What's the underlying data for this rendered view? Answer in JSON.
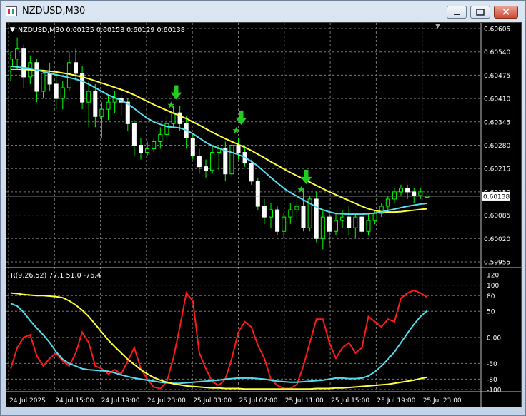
{
  "window": {
    "title": "NZDUSD,M30",
    "minimize_label": "",
    "maximize_label": "",
    "close_label": "×"
  },
  "chart_info": "NZDUSD,M30  0.60135 0.60158 0.60129 0.60138",
  "price_axis_labels": [
    "0.60605",
    "0.60540",
    "0.60475",
    "0.60410",
    "0.60345",
    "0.60280",
    "0.60215",
    "0.60150",
    "0.60085",
    "0.60020",
    "0.59955"
  ],
  "current_price": "0.60138",
  "indicator_info": "R(9,26,52) 77.1 51.0 -76.4",
  "indicator_axis_labels": [
    "120",
    "100",
    "80",
    "50",
    "0.00",
    "-50",
    "-80",
    "-100"
  ],
  "time_labels": [
    "24 Jul 2025",
    "24 Jul 15:00",
    "24 Jul 19:00",
    "24 Jul 23:00",
    "25 Jul 03:00",
    "25 Jul 07:00",
    "25 Jul 11:00",
    "25 Jul 15:00",
    "25 Jul 19:00",
    "25 Jul 23:00"
  ],
  "colors": {
    "background": "#000000",
    "bull_candle": "#ffffff",
    "bear_candle": "#00ff00",
    "fast_ma": "#55dded",
    "slow_ma": "#ffff3c",
    "signal_arrow": "#22cc22",
    "osc_fast": "#ff1a1a",
    "osc_mid": "#55dded",
    "osc_slow": "#ffff3c",
    "grid": "#777777"
  },
  "chart_data": [
    {
      "type": "candlestick",
      "symbol": "NZDUSD",
      "timeframe": "M30",
      "ylim": [
        0.59955,
        0.60605
      ],
      "candles": [
        {
          "o": 0.605,
          "h": 0.6054,
          "l": 0.6046,
          "c": 0.6052
        },
        {
          "o": 0.6052,
          "h": 0.6058,
          "l": 0.6049,
          "c": 0.6055
        },
        {
          "o": 0.6055,
          "h": 0.6056,
          "l": 0.6044,
          "c": 0.6047
        },
        {
          "o": 0.6047,
          "h": 0.6053,
          "l": 0.6045,
          "c": 0.6051
        },
        {
          "o": 0.6051,
          "h": 0.6052,
          "l": 0.604,
          "c": 0.6043
        },
        {
          "o": 0.6043,
          "h": 0.6049,
          "l": 0.6041,
          "c": 0.6048
        },
        {
          "o": 0.6048,
          "h": 0.6051,
          "l": 0.6043,
          "c": 0.6045
        },
        {
          "o": 0.6045,
          "h": 0.6048,
          "l": 0.6038,
          "c": 0.6041
        },
        {
          "o": 0.6041,
          "h": 0.6046,
          "l": 0.6038,
          "c": 0.6044
        },
        {
          "o": 0.6044,
          "h": 0.6054,
          "l": 0.6043,
          "c": 0.6051
        },
        {
          "o": 0.6051,
          "h": 0.6055,
          "l": 0.6046,
          "c": 0.6048
        },
        {
          "o": 0.6048,
          "h": 0.605,
          "l": 0.6038,
          "c": 0.604
        },
        {
          "o": 0.604,
          "h": 0.6046,
          "l": 0.6033,
          "c": 0.6043
        },
        {
          "o": 0.6043,
          "h": 0.6045,
          "l": 0.6033,
          "c": 0.6036
        },
        {
          "o": 0.6036,
          "h": 0.604,
          "l": 0.603,
          "c": 0.6038
        },
        {
          "o": 0.6038,
          "h": 0.6042,
          "l": 0.6035,
          "c": 0.604
        },
        {
          "o": 0.604,
          "h": 0.6043,
          "l": 0.6037,
          "c": 0.6041
        },
        {
          "o": 0.6041,
          "h": 0.6042,
          "l": 0.6036,
          "c": 0.604
        },
        {
          "o": 0.604,
          "h": 0.6041,
          "l": 0.6032,
          "c": 0.6034
        },
        {
          "o": 0.6034,
          "h": 0.6035,
          "l": 0.6025,
          "c": 0.6028
        },
        {
          "o": 0.6028,
          "h": 0.603,
          "l": 0.6024,
          "c": 0.6026
        },
        {
          "o": 0.6026,
          "h": 0.6029,
          "l": 0.6025,
          "c": 0.6027
        },
        {
          "o": 0.6027,
          "h": 0.603,
          "l": 0.6026,
          "c": 0.6029
        },
        {
          "o": 0.6029,
          "h": 0.6033,
          "l": 0.6027,
          "c": 0.6031
        },
        {
          "o": 0.6031,
          "h": 0.6036,
          "l": 0.6029,
          "c": 0.6034
        },
        {
          "o": 0.6034,
          "h": 0.6039,
          "l": 0.6033,
          "c": 0.6037
        },
        {
          "o": 0.6037,
          "h": 0.6039,
          "l": 0.6032,
          "c": 0.6034
        },
        {
          "o": 0.6034,
          "h": 0.6036,
          "l": 0.6027,
          "c": 0.603
        },
        {
          "o": 0.603,
          "h": 0.6031,
          "l": 0.6024,
          "c": 0.6025
        },
        {
          "o": 0.6025,
          "h": 0.6027,
          "l": 0.602,
          "c": 0.6022
        },
        {
          "o": 0.6022,
          "h": 0.6024,
          "l": 0.6019,
          "c": 0.6021
        },
        {
          "o": 0.6021,
          "h": 0.6028,
          "l": 0.602,
          "c": 0.6026
        },
        {
          "o": 0.6026,
          "h": 0.6028,
          "l": 0.6021,
          "c": 0.6027
        },
        {
          "o": 0.6027,
          "h": 0.6029,
          "l": 0.6018,
          "c": 0.602
        },
        {
          "o": 0.602,
          "h": 0.603,
          "l": 0.6019,
          "c": 0.6028
        },
        {
          "o": 0.6028,
          "h": 0.603,
          "l": 0.6024,
          "c": 0.6026
        },
        {
          "o": 0.6026,
          "h": 0.6028,
          "l": 0.6022,
          "c": 0.6023
        },
        {
          "o": 0.6023,
          "h": 0.6024,
          "l": 0.6017,
          "c": 0.6018
        },
        {
          "o": 0.6018,
          "h": 0.6019,
          "l": 0.601,
          "c": 0.6011
        },
        {
          "o": 0.6011,
          "h": 0.6013,
          "l": 0.6006,
          "c": 0.6008
        },
        {
          "o": 0.6008,
          "h": 0.6012,
          "l": 0.6005,
          "c": 0.601
        },
        {
          "o": 0.601,
          "h": 0.6011,
          "l": 0.6003,
          "c": 0.6004
        },
        {
          "o": 0.6004,
          "h": 0.6009,
          "l": 0.6002,
          "c": 0.6008
        },
        {
          "o": 0.6008,
          "h": 0.6012,
          "l": 0.6006,
          "c": 0.601
        },
        {
          "o": 0.601,
          "h": 0.6013,
          "l": 0.6007,
          "c": 0.6011
        },
        {
          "o": 0.6011,
          "h": 0.6016,
          "l": 0.6004,
          "c": 0.6005
        },
        {
          "o": 0.6005,
          "h": 0.6014,
          "l": 0.6004,
          "c": 0.6013
        },
        {
          "o": 0.6013,
          "h": 0.6015,
          "l": 0.6001,
          "c": 0.6002
        },
        {
          "o": 0.6002,
          "h": 0.601,
          "l": 0.5999,
          "c": 0.6008
        },
        {
          "o": 0.6008,
          "h": 0.601,
          "l": 0.6,
          "c": 0.6004
        },
        {
          "o": 0.6004,
          "h": 0.6009,
          "l": 0.6003,
          "c": 0.6007
        },
        {
          "o": 0.6007,
          "h": 0.601,
          "l": 0.6005,
          "c": 0.6008
        },
        {
          "o": 0.6008,
          "h": 0.6011,
          "l": 0.6003,
          "c": 0.6005
        },
        {
          "o": 0.6005,
          "h": 0.6009,
          "l": 0.6002,
          "c": 0.6008
        },
        {
          "o": 0.6008,
          "h": 0.6009,
          "l": 0.6003,
          "c": 0.6004
        },
        {
          "o": 0.6004,
          "h": 0.6009,
          "l": 0.6003,
          "c": 0.6007
        },
        {
          "o": 0.6007,
          "h": 0.601,
          "l": 0.6006,
          "c": 0.6009
        },
        {
          "o": 0.6009,
          "h": 0.6012,
          "l": 0.6008,
          "c": 0.6011
        },
        {
          "o": 0.6011,
          "h": 0.6014,
          "l": 0.601,
          "c": 0.6013
        },
        {
          "o": 0.6013,
          "h": 0.6016,
          "l": 0.6012,
          "c": 0.6015
        },
        {
          "o": 0.6015,
          "h": 0.6017,
          "l": 0.6014,
          "c": 0.6016
        },
        {
          "o": 0.6016,
          "h": 0.6017,
          "l": 0.6013,
          "c": 0.6015
        },
        {
          "o": 0.6015,
          "h": 0.6016,
          "l": 0.6012,
          "c": 0.6014
        },
        {
          "o": 0.6014,
          "h": 0.6016,
          "l": 0.6013,
          "c": 0.6015
        },
        {
          "o": 0.60135,
          "h": 0.60158,
          "l": 0.60129,
          "c": 0.60138
        }
      ],
      "fast_ma": [
        0.605,
        0.60498,
        0.60496,
        0.60494,
        0.6049,
        0.60485,
        0.6048,
        0.60476,
        0.60472,
        0.60468,
        0.60464,
        0.60458,
        0.6045,
        0.6044,
        0.6043,
        0.6042,
        0.60412,
        0.60405,
        0.60395,
        0.60382,
        0.60368,
        0.60355,
        0.60345,
        0.60338,
        0.60332,
        0.6033,
        0.60328,
        0.60322,
        0.60312,
        0.603,
        0.60288,
        0.60278,
        0.60272,
        0.60265,
        0.6026,
        0.60254,
        0.60246,
        0.60235,
        0.60222,
        0.60206,
        0.6019,
        0.60175,
        0.6016,
        0.60148,
        0.60138,
        0.60128,
        0.60118,
        0.60108,
        0.601,
        0.60094,
        0.6009,
        0.60089,
        0.60088,
        0.60088,
        0.60088,
        0.60089,
        0.60091,
        0.60094,
        0.60098,
        0.60102,
        0.60106,
        0.6011,
        0.60113,
        0.60116,
        0.60118
      ],
      "slow_ma": [
        0.60492,
        0.60492,
        0.60491,
        0.6049,
        0.60489,
        0.60488,
        0.60486,
        0.60484,
        0.60481,
        0.60478,
        0.60474,
        0.6047,
        0.60465,
        0.60459,
        0.60453,
        0.60447,
        0.60441,
        0.60435,
        0.60428,
        0.6042,
        0.60411,
        0.60402,
        0.60393,
        0.60385,
        0.60377,
        0.60369,
        0.60362,
        0.60354,
        0.60345,
        0.60336,
        0.60326,
        0.60316,
        0.60307,
        0.60298,
        0.6029,
        0.60282,
        0.60274,
        0.60265,
        0.60255,
        0.60245,
        0.60234,
        0.60224,
        0.60214,
        0.60204,
        0.60195,
        0.60186,
        0.60177,
        0.60168,
        0.60159,
        0.6015,
        0.60142,
        0.60134,
        0.60126,
        0.60118,
        0.6011,
        0.60103,
        0.60098,
        0.60095,
        0.60094,
        0.60094,
        0.60095,
        0.60097,
        0.60099,
        0.60101,
        0.60103
      ],
      "signals": [
        {
          "index": 25,
          "price": 0.60395
        },
        {
          "index": 35,
          "price": 0.60325
        },
        {
          "index": 45,
          "price": 0.6016
        }
      ]
    },
    {
      "type": "line",
      "title": "R(9,26,52) 77.1 51.0 -76.4",
      "ylim": [
        -100,
        120
      ],
      "series": [
        {
          "values": [
            -60,
            -20,
            0,
            5,
            -35,
            -55,
            -40,
            -30,
            -45,
            -55,
            -30,
            10,
            -10,
            -55,
            -60,
            -70,
            -62,
            -70,
            -45,
            -20,
            -60,
            -80,
            -95,
            -98,
            -85,
            -40,
            20,
            85,
            70,
            -30,
            -60,
            -85,
            -92,
            -80,
            -40,
            10,
            30,
            20,
            -15,
            -40,
            -80,
            -92,
            -98,
            -98,
            -90,
            -55,
            -10,
            35,
            35,
            -10,
            -40,
            -20,
            -10,
            -30,
            -20,
            40,
            30,
            20,
            35,
            30,
            75,
            85,
            90,
            85,
            77.1
          ]
        },
        {
          "values": [
            65,
            60,
            48,
            32,
            18,
            5,
            -10,
            -28,
            -42,
            -50,
            -55,
            -60,
            -62,
            -63,
            -64,
            -65,
            -68,
            -72,
            -75,
            -78,
            -80,
            -82,
            -84,
            -86,
            -87,
            -88,
            -88,
            -87,
            -86,
            -85,
            -84,
            -83,
            -82,
            -80,
            -79,
            -78,
            -78,
            -78,
            -79,
            -80,
            -82,
            -84,
            -85,
            -86,
            -86,
            -85,
            -84,
            -83,
            -82,
            -80,
            -78,
            -78,
            -79,
            -79,
            -78,
            -74,
            -66,
            -55,
            -42,
            -28,
            -10,
            8,
            25,
            40,
            51.0
          ]
        },
        {
          "values": [
            85,
            84,
            82,
            81,
            80,
            80,
            79,
            78,
            76,
            70,
            62,
            52,
            40,
            25,
            10,
            -5,
            -18,
            -30,
            -42,
            -52,
            -62,
            -70,
            -77,
            -82,
            -86,
            -89,
            -91,
            -93,
            -94,
            -95,
            -96,
            -97,
            -97,
            -98,
            -98,
            -98,
            -99,
            -99,
            -99,
            -99,
            -99,
            -99,
            -99,
            -99,
            -99,
            -99,
            -99,
            -98,
            -98,
            -98,
            -97,
            -97,
            -96,
            -95,
            -94,
            -93,
            -92,
            -91,
            -90,
            -88,
            -86,
            -84,
            -82,
            -79,
            -76.4
          ]
        }
      ]
    }
  ]
}
